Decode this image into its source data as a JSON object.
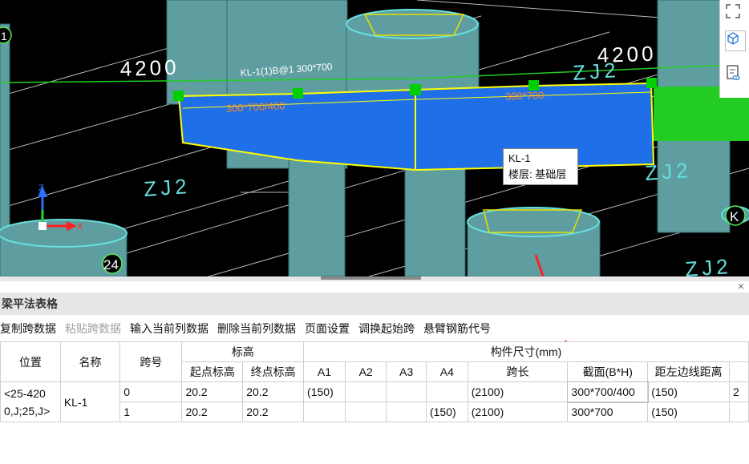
{
  "viewport": {
    "dims": {
      "left": "4200",
      "right": "4200"
    },
    "beam_labels": {
      "top_left": "KL-1(1)B@1 300*700",
      "left_section": "300*700/400",
      "right_section": "300*700"
    },
    "axis_labels": {
      "zj2_upper": "ZJ2",
      "zj2_left": "ZJ2",
      "zj2_mid": "ZJ2",
      "zj2_right": "ZJ2",
      "zj2_top": "ZJ2"
    },
    "grid_bubbles": {
      "bottom": "24",
      "right": "K",
      "left_top": "1"
    },
    "axes": {
      "x": "X",
      "y": "Y",
      "z": "Z"
    },
    "tooltip": {
      "name": "KL-1",
      "floor": "楼层: 基础层"
    },
    "colors": {
      "beam": "#1f6fe8",
      "beam_edge": "#ffff00",
      "pillar": "#5f9ea0",
      "grip": "#00d000",
      "arrow": "#ff2020",
      "green_beam": "#22cc22"
    },
    "toolbar_icons": [
      "fullscreen-icon",
      "cube-icon",
      "layers-eye-icon"
    ]
  },
  "panel": {
    "title": "梁平法表格",
    "close": "×",
    "toolbar": [
      {
        "label": "复制跨数据",
        "enabled": true
      },
      {
        "label": "粘贴跨数据",
        "enabled": false
      },
      {
        "label": "输入当前列数据",
        "enabled": true
      },
      {
        "label": "删除当前列数据",
        "enabled": true
      },
      {
        "label": "页面设置",
        "enabled": true
      },
      {
        "label": "调换起始跨",
        "enabled": true
      },
      {
        "label": "悬臂钢筋代号",
        "enabled": true
      }
    ],
    "headers": {
      "position": "位置",
      "name": "名称",
      "span_no": "跨号",
      "elevation": "标高",
      "start_elev": "起点标高",
      "end_elev": "终点标高",
      "dims": "构件尺寸(mm)",
      "a1": "A1",
      "a2": "A2",
      "a3": "A3",
      "a4": "A4",
      "span_len": "跨长",
      "section": "截面(B*H)",
      "left_dist": "距左边线距离"
    },
    "rows": [
      {
        "position": "<25-420\n0,J;25,J>",
        "name": "KL-1",
        "span_no": "0",
        "start_elev": "20.2",
        "end_elev": "20.2",
        "a1": "(150)",
        "a2": "",
        "a3": "",
        "a4": "",
        "span_len": "(2100)",
        "section": "300*700/400",
        "left_dist": "(150)",
        "extra": "2"
      },
      {
        "span_no": "1",
        "start_elev": "20.2",
        "end_elev": "20.2",
        "a1": "",
        "a2": "",
        "a3": "",
        "a4": "(150)",
        "span_len": "(2100)",
        "section": "300*700",
        "left_dist": "(150)",
        "extra": ""
      }
    ]
  }
}
